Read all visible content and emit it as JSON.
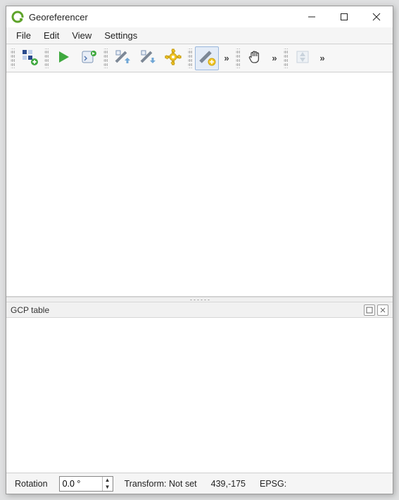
{
  "window": {
    "title": "Georeferencer"
  },
  "menu": {
    "file": "File",
    "edit": "Edit",
    "view": "View",
    "settings": "Settings"
  },
  "toolbar": {
    "overflow_glyph": "»",
    "icons": {
      "open_raster": "open-raster-icon",
      "start": "start-georef-icon",
      "generate_script": "generate-gdal-script-icon",
      "load_gcps": "load-gcp-icon",
      "save_gcps": "save-gcp-icon",
      "transformation_settings": "transformation-settings-icon",
      "add_point": "add-point-icon",
      "pan": "pan-icon",
      "zoom": "zoom-icon"
    }
  },
  "panels": {
    "gcp_table_title": "GCP table"
  },
  "status": {
    "rotation_label": "Rotation",
    "rotation_value": "0.0 °",
    "transform_label": "Transform:",
    "transform_value": "Not set",
    "coords": "439,-175",
    "epsg_label": "EPSG:"
  }
}
